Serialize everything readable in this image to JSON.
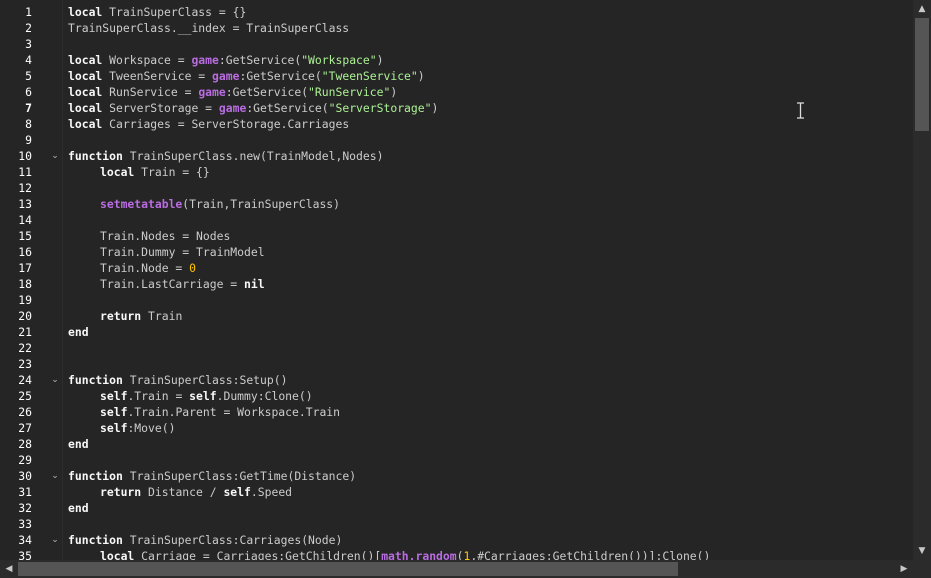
{
  "editor": {
    "current_line": "7",
    "lines": [
      {
        "n": "1",
        "fold": false,
        "indent": 0,
        "tokens": [
          [
            "kw",
            "local"
          ],
          [
            "t",
            " TrainSuperClass = "
          ],
          [
            "pn",
            "{}"
          ]
        ]
      },
      {
        "n": "2",
        "fold": false,
        "indent": 0,
        "tokens": [
          [
            "t",
            "TrainSuperClass.__index = TrainSuperClass"
          ]
        ]
      },
      {
        "n": "3",
        "fold": false,
        "indent": 0,
        "tokens": []
      },
      {
        "n": "4",
        "fold": false,
        "indent": 0,
        "tokens": [
          [
            "kw",
            "local"
          ],
          [
            "t",
            " Workspace = "
          ],
          [
            "bi",
            "game"
          ],
          [
            "t",
            ":GetService"
          ],
          [
            "pn",
            "("
          ],
          [
            "st",
            "\"Workspace\""
          ],
          [
            "pn",
            ")"
          ]
        ]
      },
      {
        "n": "5",
        "fold": false,
        "indent": 0,
        "tokens": [
          [
            "kw",
            "local"
          ],
          [
            "t",
            " TweenService = "
          ],
          [
            "bi",
            "game"
          ],
          [
            "t",
            ":GetService"
          ],
          [
            "pn",
            "("
          ],
          [
            "st",
            "\"TweenService\""
          ],
          [
            "pn",
            ")"
          ]
        ]
      },
      {
        "n": "6",
        "fold": false,
        "indent": 0,
        "tokens": [
          [
            "kw",
            "local"
          ],
          [
            "t",
            " RunService = "
          ],
          [
            "bi",
            "game"
          ],
          [
            "t",
            ":GetService"
          ],
          [
            "pn",
            "("
          ],
          [
            "st",
            "\"RunService\""
          ],
          [
            "pn",
            ")"
          ]
        ]
      },
      {
        "n": "7",
        "fold": false,
        "indent": 0,
        "tokens": [
          [
            "kw",
            "local"
          ],
          [
            "t",
            " ServerStorage = "
          ],
          [
            "bi",
            "game"
          ],
          [
            "t",
            ":GetService"
          ],
          [
            "pn",
            "("
          ],
          [
            "st",
            "\"ServerStorage\""
          ],
          [
            "pn",
            ")"
          ]
        ]
      },
      {
        "n": "8",
        "fold": false,
        "indent": 0,
        "tokens": [
          [
            "kw",
            "local"
          ],
          [
            "t",
            " Carriages = ServerStorage.Carriages"
          ]
        ]
      },
      {
        "n": "9",
        "fold": false,
        "indent": 0,
        "tokens": []
      },
      {
        "n": "10",
        "fold": true,
        "indent": 0,
        "tokens": [
          [
            "kw",
            "function"
          ],
          [
            "t",
            " TrainSuperClass.new"
          ],
          [
            "pn",
            "("
          ],
          [
            "t",
            "TrainModel,Nodes"
          ],
          [
            "pn",
            ")"
          ]
        ]
      },
      {
        "n": "11",
        "fold": false,
        "indent": 1,
        "tokens": [
          [
            "kw",
            "local"
          ],
          [
            "t",
            " Train = "
          ],
          [
            "pn",
            "{}"
          ]
        ]
      },
      {
        "n": "12",
        "fold": false,
        "indent": 0,
        "tokens": []
      },
      {
        "n": "13",
        "fold": false,
        "indent": 1,
        "tokens": [
          [
            "bi",
            "setmetatable"
          ],
          [
            "pn",
            "("
          ],
          [
            "t",
            "Train,TrainSuperClass"
          ],
          [
            "pn",
            ")"
          ]
        ]
      },
      {
        "n": "14",
        "fold": false,
        "indent": 0,
        "tokens": []
      },
      {
        "n": "15",
        "fold": false,
        "indent": 1,
        "tokens": [
          [
            "t",
            "Train.Nodes = Nodes"
          ]
        ]
      },
      {
        "n": "16",
        "fold": false,
        "indent": 1,
        "tokens": [
          [
            "t",
            "Train.Dummy = TrainModel"
          ]
        ]
      },
      {
        "n": "17",
        "fold": false,
        "indent": 1,
        "tokens": [
          [
            "t",
            "Train.Node = "
          ],
          [
            "nu",
            "0"
          ]
        ]
      },
      {
        "n": "18",
        "fold": false,
        "indent": 1,
        "tokens": [
          [
            "t",
            "Train.LastCarriage = "
          ],
          [
            "kw",
            "nil"
          ]
        ]
      },
      {
        "n": "19",
        "fold": false,
        "indent": 0,
        "tokens": []
      },
      {
        "n": "20",
        "fold": false,
        "indent": 1,
        "tokens": [
          [
            "kw",
            "return"
          ],
          [
            "t",
            " Train"
          ]
        ]
      },
      {
        "n": "21",
        "fold": false,
        "indent": 0,
        "tokens": [
          [
            "kw",
            "end"
          ]
        ]
      },
      {
        "n": "22",
        "fold": false,
        "indent": 0,
        "tokens": []
      },
      {
        "n": "23",
        "fold": false,
        "indent": 0,
        "tokens": []
      },
      {
        "n": "24",
        "fold": true,
        "indent": 0,
        "tokens": [
          [
            "kw",
            "function"
          ],
          [
            "t",
            " TrainSuperClass:Setup"
          ],
          [
            "pn",
            "()"
          ]
        ]
      },
      {
        "n": "25",
        "fold": false,
        "indent": 1,
        "tokens": [
          [
            "kw",
            "self"
          ],
          [
            "t",
            ".Train = "
          ],
          [
            "kw",
            "self"
          ],
          [
            "t",
            ".Dummy:Clone"
          ],
          [
            "pn",
            "()"
          ]
        ]
      },
      {
        "n": "26",
        "fold": false,
        "indent": 1,
        "tokens": [
          [
            "kw",
            "self"
          ],
          [
            "t",
            ".Train.Parent = Workspace.Train"
          ]
        ]
      },
      {
        "n": "27",
        "fold": false,
        "indent": 1,
        "tokens": [
          [
            "kw",
            "self"
          ],
          [
            "t",
            ":Move"
          ],
          [
            "pn",
            "()"
          ]
        ]
      },
      {
        "n": "28",
        "fold": false,
        "indent": 0,
        "tokens": [
          [
            "kw",
            "end"
          ]
        ]
      },
      {
        "n": "29",
        "fold": false,
        "indent": 0,
        "tokens": []
      },
      {
        "n": "30",
        "fold": true,
        "indent": 0,
        "tokens": [
          [
            "kw",
            "function"
          ],
          [
            "t",
            " TrainSuperClass:GetTime"
          ],
          [
            "pn",
            "("
          ],
          [
            "t",
            "Distance"
          ],
          [
            "pn",
            ")"
          ]
        ]
      },
      {
        "n": "31",
        "fold": false,
        "indent": 1,
        "tokens": [
          [
            "kw",
            "return"
          ],
          [
            "t",
            " Distance / "
          ],
          [
            "kw",
            "self"
          ],
          [
            "t",
            ".Speed"
          ]
        ]
      },
      {
        "n": "32",
        "fold": false,
        "indent": 0,
        "tokens": [
          [
            "kw",
            "end"
          ]
        ]
      },
      {
        "n": "33",
        "fold": false,
        "indent": 0,
        "tokens": []
      },
      {
        "n": "34",
        "fold": true,
        "indent": 0,
        "tokens": [
          [
            "kw",
            "function"
          ],
          [
            "t",
            " TrainSuperClass:Carriages"
          ],
          [
            "pn",
            "("
          ],
          [
            "t",
            "Node"
          ],
          [
            "pn",
            ")"
          ]
        ]
      },
      {
        "n": "35",
        "fold": false,
        "indent": 1,
        "tokens": [
          [
            "kw",
            "local"
          ],
          [
            "t",
            " Carriage = Carriages:GetChildren"
          ],
          [
            "pn",
            "()"
          ],
          [
            "pn",
            "["
          ],
          [
            "bi",
            "math.random"
          ],
          [
            "pn",
            "("
          ],
          [
            "nu",
            "1"
          ],
          [
            "t",
            ",#Carriages:GetChildren"
          ],
          [
            "pn",
            "()"
          ],
          [
            "pn",
            ")"
          ],
          [
            "pn",
            "]"
          ],
          [
            "t",
            ":Clone"
          ],
          [
            "pn",
            "()"
          ]
        ]
      }
    ]
  },
  "icons": {
    "fold": "chevron-down-icon",
    "cursor": "text-cursor-icon",
    "scroll_up": "arrow-up-icon",
    "scroll_down": "arrow-down-icon",
    "scroll_left": "arrow-left-icon",
    "scroll_right": "arrow-right-icon"
  },
  "colors": {
    "background": "#252525",
    "text": "#cccccc",
    "keyword": "#f8f8f8",
    "builtin": "#b96de0",
    "string": "#adf195",
    "number": "#ffc600"
  }
}
